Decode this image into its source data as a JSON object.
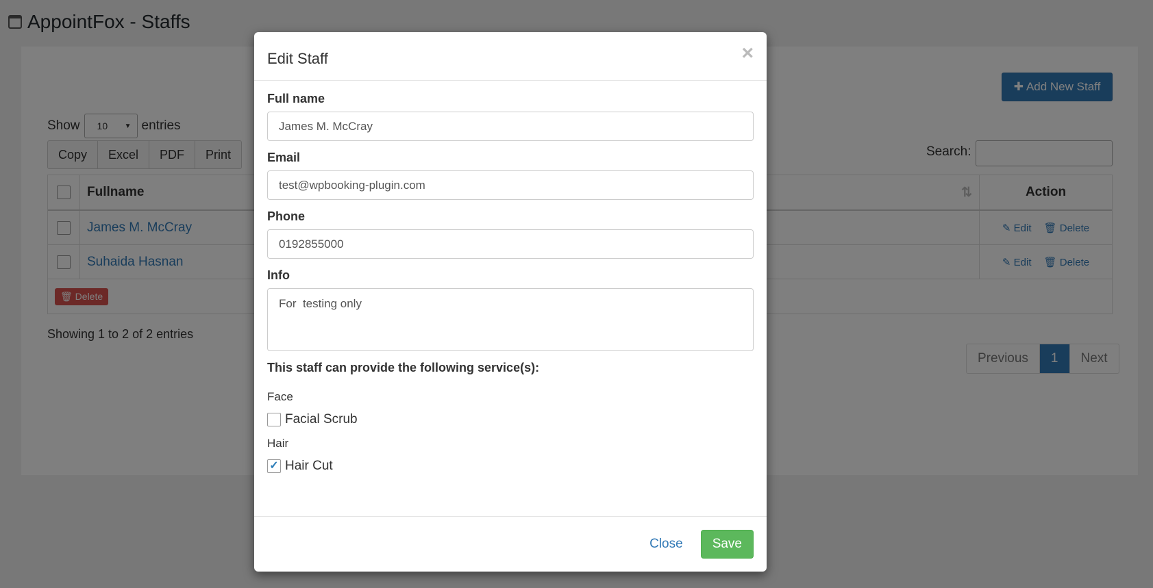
{
  "page": {
    "title": "AppointFox - Staffs"
  },
  "toolbar": {
    "add_label": "Add New Staff"
  },
  "entries": {
    "show_label": "Show",
    "value": "10",
    "suffix": "entries"
  },
  "export": {
    "copy": "Copy",
    "excel": "Excel",
    "pdf": "PDF",
    "print": "Print"
  },
  "search": {
    "label": "Search:"
  },
  "table": {
    "headers": {
      "fullname": "Fullname",
      "action": "Action"
    },
    "rows": [
      {
        "name": "James M. McCray",
        "edit": "Edit",
        "delete": "Delete"
      },
      {
        "name": "Suhaida Hasnan",
        "edit": "Edit",
        "delete": "Delete"
      }
    ],
    "bulk_delete": "Delete"
  },
  "info": {
    "showing": "Showing 1 to 2 of 2 entries"
  },
  "pagination": {
    "previous": "Previous",
    "current": "1",
    "next": "Next"
  },
  "modal": {
    "title": "Edit Staff",
    "close_glyph": "×",
    "fullname_label": "Full name",
    "fullname_value": "James M. McCray",
    "email_label": "Email",
    "email_value": "test@wpbooking-plugin.com",
    "phone_label": "Phone",
    "phone_value": "0192855000",
    "info_label": "Info",
    "info_value": "For  testing only",
    "services_title": "This staff can provide the following service(s):",
    "groups": [
      {
        "label": "Face",
        "service": "Facial Scrub",
        "checked": false
      },
      {
        "label": "Hair",
        "service": "Hair Cut",
        "checked": true
      }
    ],
    "close_label": "Close",
    "save_label": "Save"
  },
  "colors": {
    "primary": "#337ab7",
    "success": "#5cb85c",
    "danger": "#d9534f"
  }
}
